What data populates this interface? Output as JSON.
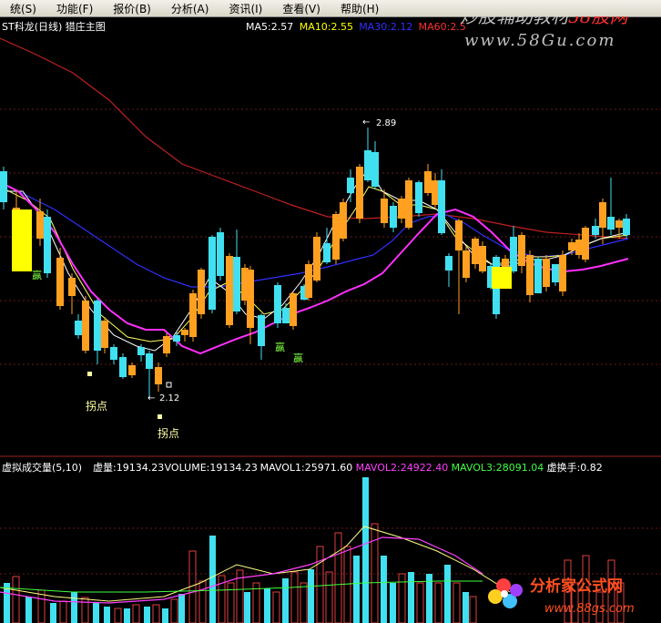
{
  "menu": [
    "统(S)",
    "功能(F)",
    "报价(B)",
    "分析(A)",
    "资讯(I)",
    "查看(V)",
    "帮助(H)"
  ],
  "watermark_top": {
    "line1": "炒股辅助教材",
    "line1_accent": "58股网",
    "line2": "www.58Gu.com"
  },
  "watermark_bottom": {
    "brand": "分析家公式网",
    "url": "www.88gs.com"
  },
  "price_panel": {
    "title": "ST科龙(日线) 猎庄主图",
    "ma_labels": [
      {
        "text": "MA5:2.57",
        "color": "#ffffff"
      },
      {
        "text": "MA10:2.55",
        "color": "#ffff00"
      },
      {
        "text": "MA30:2.12",
        "color": "#3030ff"
      },
      {
        "text": "MA60:2.5",
        "color": "#ff3030"
      }
    ],
    "high_label": "2.89",
    "low_label": "2.12",
    "signal_labels": [
      "赢",
      "赢",
      "赢",
      "拐点",
      "拐点"
    ]
  },
  "volume_panel": {
    "title": "虚拟成交量(5,10)",
    "labels": [
      {
        "text": "虚量:19134.23",
        "color": "#ffffff"
      },
      {
        "text": "VOLUME:19134.23",
        "color": "#ffffff"
      },
      {
        "text": "MAVOL1:25971.60",
        "color": "#ffffff"
      },
      {
        "text": "MAVOL2:24922.40",
        "color": "#ff40ff"
      },
      {
        "text": "MAVOL3:28091.04",
        "color": "#40ff40"
      },
      {
        "text": "虚换手:0.82",
        "color": "#ffffff"
      }
    ]
  },
  "colors": {
    "up": "#ffa020",
    "down": "#40e0f0",
    "ma5": "#ffffff",
    "ma10": "#ffff60",
    "ma30": "#3030ff",
    "ma60": "#c02020",
    "magenta": "#ff30ff",
    "signal_text": "#80ff40",
    "grid": "#802020"
  }
}
